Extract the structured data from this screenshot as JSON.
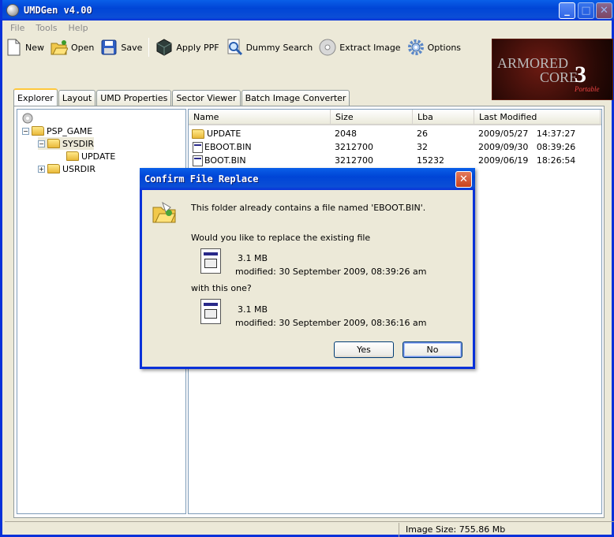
{
  "window": {
    "title": "UMDGen v4.00"
  },
  "menu": [
    "File",
    "Tools",
    "Help"
  ],
  "toolbar": {
    "new": "New",
    "open": "Open",
    "save": "Save",
    "apply_ppf": "Apply PPF",
    "dummy_search": "Dummy Search",
    "extract_image": "Extract Image",
    "options": "Options"
  },
  "logo": {
    "line1": "ARMORED",
    "line2": "CORE",
    "num": "3",
    "sub": "Portable"
  },
  "tabs": [
    "Explorer",
    "Layout",
    "UMD Properties",
    "Sector Viewer",
    "Batch Image Converter"
  ],
  "tree": {
    "root": "PSP_GAME",
    "sysdir": "SYSDIR",
    "update": "UPDATE",
    "usrdir": "USRDIR"
  },
  "list": {
    "headers": [
      "Name",
      "Size",
      "Lba",
      "Last Modified"
    ],
    "rows": [
      {
        "name": "UPDATE",
        "size": "2048",
        "lba": "26",
        "date": "2009/05/27",
        "time": "14:37:27",
        "icon": "folder-icon"
      },
      {
        "name": "EBOOT.BIN",
        "size": "3212700",
        "lba": "32",
        "date": "2009/09/30",
        "time": "08:39:26",
        "icon": "file-icon"
      },
      {
        "name": "BOOT.BIN",
        "size": "3212700",
        "lba": "15232",
        "date": "2009/06/19",
        "time": "18:26:54",
        "icon": "file-icon"
      }
    ]
  },
  "status": {
    "image_size": "Image Size: 755.86 Mb"
  },
  "dialog": {
    "title": "Confirm File Replace",
    "message": "This folder already contains a file named 'EBOOT.BIN'.",
    "question": "Would you like to replace the existing file",
    "existing_size": "3.1 MB",
    "existing_modified": "modified: 30 September 2009, 08:39:26 am",
    "with_this": "with this one?",
    "new_size": "3.1 MB",
    "new_modified": "modified: 30 September 2009, 08:36:16 am",
    "yes": "Yes",
    "no": "No"
  },
  "colors": {
    "titlebar": "#0045d6",
    "face": "#ece9d8",
    "active_tab": "#ffc83c"
  }
}
